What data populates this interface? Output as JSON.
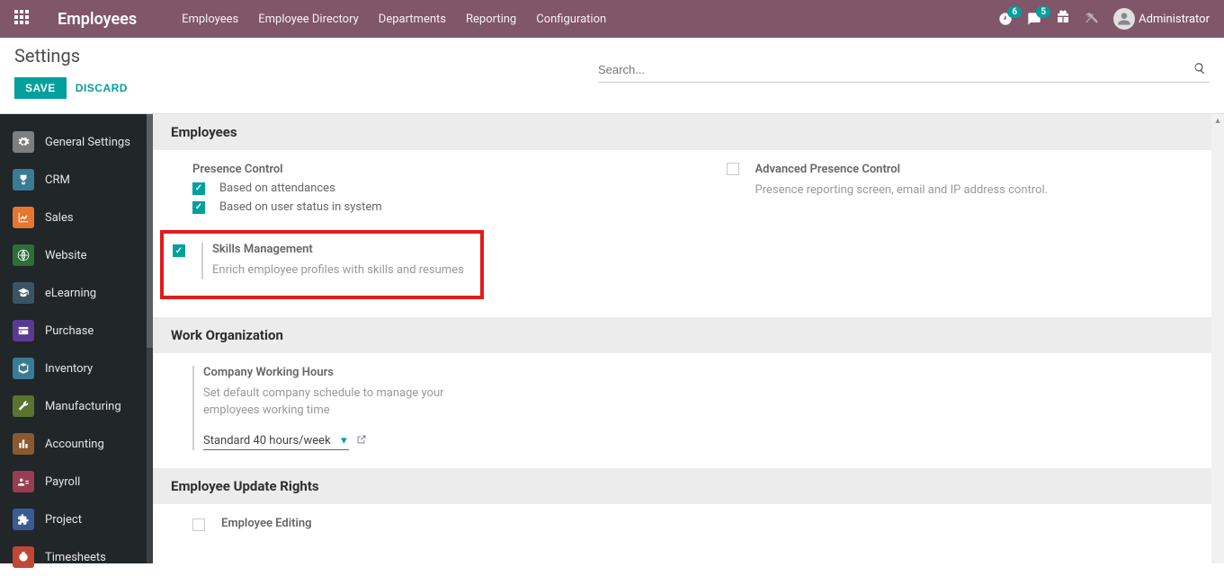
{
  "app_title": "Employees",
  "topnav": [
    "Employees",
    "Employee Directory",
    "Departments",
    "Reporting",
    "Configuration"
  ],
  "badges": {
    "activities": "6",
    "messages": "5"
  },
  "user_name": "Administrator",
  "breadcrumb": "Settings",
  "buttons": {
    "save": "SAVE",
    "discard": "DISCARD"
  },
  "search_placeholder": "Search...",
  "sidebar": [
    "General Settings",
    "CRM",
    "Sales",
    "Website",
    "eLearning",
    "Purchase",
    "Inventory",
    "Manufacturing",
    "Accounting",
    "Payroll",
    "Project",
    "Timesheets"
  ],
  "sections": {
    "employees": {
      "title": "Employees",
      "presence_control": {
        "title": "Presence Control",
        "opt1": "Based on attendances",
        "opt2": "Based on user status in system"
      },
      "skills": {
        "title": "Skills Management",
        "desc": "Enrich employee profiles with skills and resumes"
      },
      "advanced": {
        "title": "Advanced Presence Control",
        "desc": "Presence reporting screen, email and IP address control."
      }
    },
    "work_org": {
      "title": "Work Organization",
      "cwh": {
        "title": "Company Working Hours",
        "desc": "Set default company schedule to manage your employees working time",
        "value": "Standard 40 hours/week"
      }
    },
    "update_rights": {
      "title": "Employee Update Rights",
      "editing": "Employee Editing"
    }
  }
}
